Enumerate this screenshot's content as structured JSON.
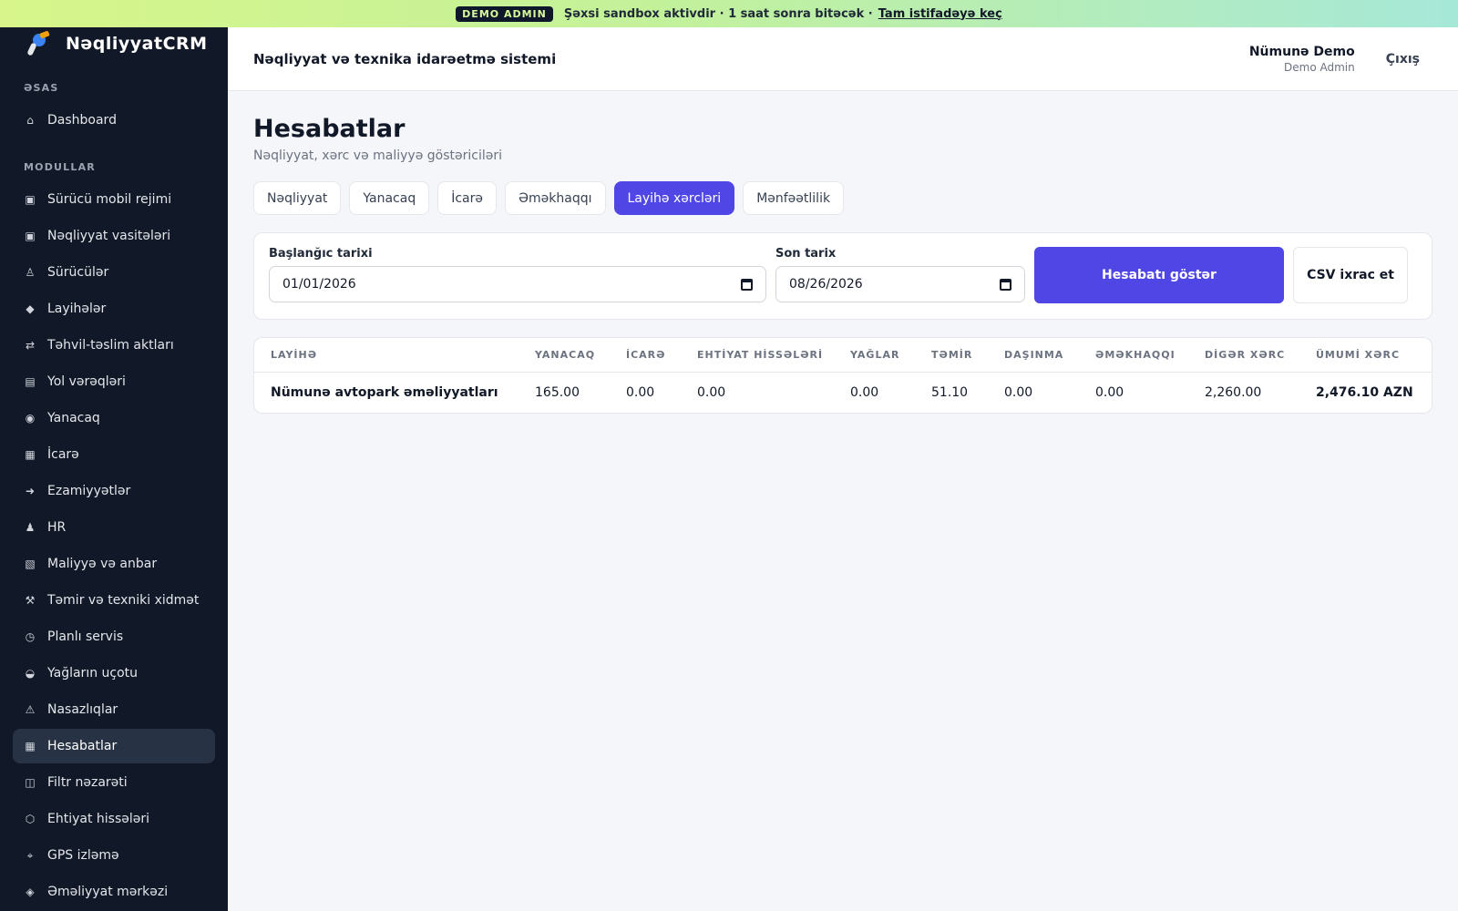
{
  "banner": {
    "tag": "DEMO ADMIN",
    "message": "Şəxsi sandbox aktivdir · 1 saat sonra bitəcək ·",
    "link": "Tam istifadəyə keç"
  },
  "sidebar": {
    "brand": "NəqliyyatCRM",
    "sections": {
      "main": "ƏSAS",
      "modules": "MODULLAR"
    },
    "dashboard": {
      "icon": "home-icon",
      "glyph": "⌂",
      "label": "Dashboard"
    },
    "items": [
      {
        "icon": "phone-icon",
        "glyph": "▣",
        "label": "Sürücü mobil rejimi"
      },
      {
        "icon": "truck-icon",
        "glyph": "▣",
        "label": "Nəqliyyat vasitələri"
      },
      {
        "icon": "driver-icon",
        "glyph": "♙",
        "label": "Sürücülər"
      },
      {
        "icon": "diamond-icon",
        "glyph": "◆",
        "label": "Layihələr"
      },
      {
        "icon": "transfer-icon",
        "glyph": "⇄",
        "label": "Təhvil-təslim aktları"
      },
      {
        "icon": "waybill-icon",
        "glyph": "▤",
        "label": "Yol vərəqləri"
      },
      {
        "icon": "fuel-icon",
        "glyph": "◉",
        "label": "Yanacaq"
      },
      {
        "icon": "rent-icon",
        "glyph": "▦",
        "label": "İcarə"
      },
      {
        "icon": "arrow-right-icon",
        "glyph": "➜",
        "label": "Ezamiyyətlər"
      },
      {
        "icon": "person-icon",
        "glyph": "♟",
        "label": "HR"
      },
      {
        "icon": "finance-icon",
        "glyph": "▧",
        "label": "Maliyyə və anbar"
      },
      {
        "icon": "tools-icon",
        "glyph": "⚒",
        "label": "Təmir və texniki xidmət"
      },
      {
        "icon": "clock-icon",
        "glyph": "◷",
        "label": "Planlı servis"
      },
      {
        "icon": "oil-icon",
        "glyph": "◒",
        "label": "Yağların uçotu"
      },
      {
        "icon": "warning-icon",
        "glyph": "⚠",
        "label": "Nasazlıqlar"
      },
      {
        "icon": "reports-icon",
        "glyph": "▦",
        "label": "Hesabatlar",
        "active": true
      },
      {
        "icon": "filter-icon",
        "glyph": "◫",
        "label": "Filtr nəzarəti"
      },
      {
        "icon": "parts-icon",
        "glyph": "⬡",
        "label": "Ehtiyat hissələri"
      },
      {
        "icon": "gps-icon",
        "glyph": "⌖",
        "label": "GPS izləmə"
      },
      {
        "icon": "ops-center-icon",
        "glyph": "◈",
        "label": "Əməliyyat mərkəzi"
      }
    ]
  },
  "header": {
    "system_title": "Nəqliyyat və texnika idarəetmə sistemi",
    "user_name": "Nümunə Demo",
    "user_role": "Demo Admin",
    "logout": "Çıxış"
  },
  "page": {
    "title": "Hesabatlar",
    "subtitle": "Nəqliyyat, xərc və maliyyə göstəriciləri"
  },
  "tabs": [
    {
      "label": "Nəqliyyat",
      "active": false
    },
    {
      "label": "Yanacaq",
      "active": false
    },
    {
      "label": "İcarə",
      "active": false
    },
    {
      "label": "Əməkhaqqı",
      "active": false
    },
    {
      "label": "Layihə xərcləri",
      "active": true
    },
    {
      "label": "Mənfəətlilik",
      "active": false
    }
  ],
  "filters": {
    "start_label": "Başlanğıc tarixi",
    "start_value": "01/01/2026",
    "end_label": "Son tarix",
    "end_value": "08/26/2026",
    "show_button": "Hesabatı göstər",
    "export_button": "CSV ixrac et"
  },
  "table": {
    "headers": [
      "LAYİHƏ",
      "YANACAQ",
      "İCARƏ",
      "EHTİYAT HİSSƏLƏRİ",
      "YAĞLAR",
      "TƏMİR",
      "DAŞINMA",
      "ƏMƏKHAQQI",
      "DİGƏR XƏRC",
      "ÜMUMİ XƏRC"
    ],
    "rows": [
      [
        "Nümunə avtopark əməliyyatları",
        "165.00",
        "0.00",
        "0.00",
        "0.00",
        "51.10",
        "0.00",
        "0.00",
        "2,260.00",
        "2,476.10 AZN"
      ]
    ]
  },
  "colors": {
    "accent": "#4f46e5",
    "sidebar_bg": "#111827",
    "sidebar_active": "#273244"
  }
}
